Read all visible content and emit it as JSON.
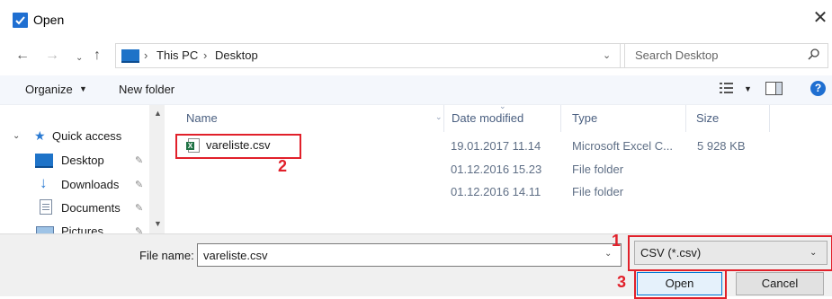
{
  "window": {
    "title": "Open",
    "close_icon": "close-icon"
  },
  "address": {
    "breadcrumb": [
      "This PC",
      "Desktop"
    ],
    "separator": "›",
    "search_placeholder": "Search Desktop"
  },
  "toolbar": {
    "organize_label": "Organize",
    "new_folder_label": "New folder"
  },
  "nav": {
    "quick_access": "Quick access",
    "items": [
      {
        "label": "Desktop",
        "icon": "desktop-icon"
      },
      {
        "label": "Downloads",
        "icon": "downloads-icon"
      },
      {
        "label": "Documents",
        "icon": "documents-icon"
      },
      {
        "label": "Pictures",
        "icon": "pictures-icon"
      }
    ]
  },
  "columns": {
    "name": "Name",
    "date": "Date modified",
    "type": "Type",
    "size": "Size"
  },
  "files": [
    {
      "name": "vareliste.csv",
      "date": "19.01.2017 11.14",
      "type": "Microsoft Excel C...",
      "size": "5 928 KB"
    },
    {
      "name": "",
      "date": "01.12.2016 15.23",
      "type": "File folder",
      "size": ""
    },
    {
      "name": "",
      "date": "01.12.2016 14.11",
      "type": "File folder",
      "size": ""
    }
  ],
  "footer": {
    "file_name_label": "File name:",
    "file_name_value": "vareliste.csv",
    "filter_value": "CSV (*.csv)",
    "open_label": "Open",
    "cancel_label": "Cancel"
  },
  "annotations": {
    "marker_1": "1",
    "marker_2": "2",
    "marker_3": "3",
    "color": "#e1202a"
  },
  "colors": {
    "accent": "#0078d7",
    "checkbox": "#1f6fd1",
    "excel_green": "#1f7244"
  }
}
